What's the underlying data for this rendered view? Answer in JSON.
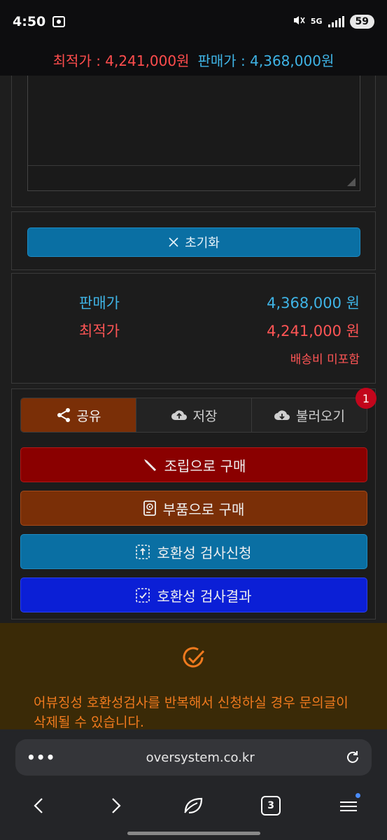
{
  "status_bar": {
    "time": "4:50",
    "network": "5G",
    "battery": "59"
  },
  "price_header": {
    "lowest_label": "최적가 : 4,241,000원",
    "sale_label": "판매가 : 4,368,000원"
  },
  "reset_button": {
    "label": "초기화"
  },
  "price_summary": {
    "sale_label": "판매가",
    "sale_value": "4,368,000 원",
    "lowest_label": "최적가",
    "lowest_value": "4,241,000 원",
    "shipping_note": "배송비 미포함"
  },
  "tabs": {
    "share": "공유",
    "save": "저장",
    "load": "불러오기",
    "load_badge": "1"
  },
  "actions": {
    "assembly": "조립으로 구매",
    "parts": "부품으로 구매",
    "compat_request": "호환성 검사신청",
    "compat_result": "호환성 검사결과"
  },
  "warning": {
    "text": "어뷰징성 호환성검사를 반복해서 신청하실 경우 문의글이 삭제될 수 있습니다."
  },
  "browser": {
    "url": "oversystem.co.kr",
    "more": "•••",
    "tab_count": "3"
  },
  "colors": {
    "sale": "#3fb4e6",
    "lowest": "#ff5555",
    "warning": "#f07a1e"
  }
}
